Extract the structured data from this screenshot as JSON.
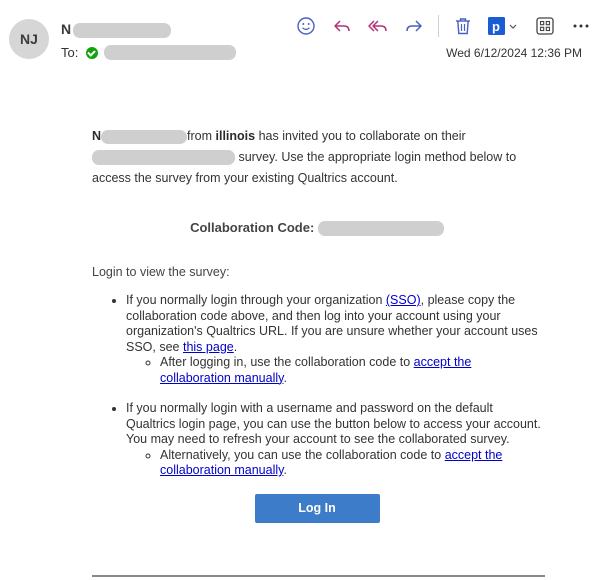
{
  "header": {
    "avatar_initials": "NJ",
    "sender_initial": "N",
    "to_label": "To:",
    "date": "Wed 6/12/2024 12:36 PM"
  },
  "toolbar": {
    "icons": [
      "emoji-icon",
      "reply-icon",
      "reply-all-icon",
      "forward-icon",
      "delete-icon",
      "pocket-icon",
      "apps-icon",
      "more-icon"
    ],
    "accent": "#4a5fc1",
    "pocket_color": "#1c5bd6"
  },
  "email": {
    "intro_name_initial": "N",
    "intro_from": "from",
    "intro_org": "illinois",
    "intro_part1": "has invited you to collaborate on their",
    "intro_part2": "survey. Use the appropriate login method below to access the survey from your existing Qualtrics account.",
    "collab_label": "Collaboration Code:",
    "login_title": "Login to view the survey:",
    "bullet1_text_a": "If you normally login through your organization",
    "bullet1_link": "(SSO)",
    "bullet1_text_b": ", please copy the collaboration code above, and then log into your account using your organization's Qualtrics URL. If you are unsure whether your account uses SSO, see",
    "bullet1_link2": "this page",
    "bullet1_text_c": ".",
    "sub1_text": "After logging in, use the collaboration code to",
    "sub1_link": "accept the collaboration manually",
    "sub1_end": ".",
    "bullet2_text": "If you normally login with a username and password on the default Qualtrics login page, you can use the button below to access your account. You may need to refresh your account to see the collaborated survey.",
    "sub2_text": "Alternatively, you can use the collaboration code to",
    "sub2_link": "accept the collaboration manually",
    "sub2_end": ".",
    "button_label": "Log In",
    "button_color": "#3d7cc9"
  }
}
